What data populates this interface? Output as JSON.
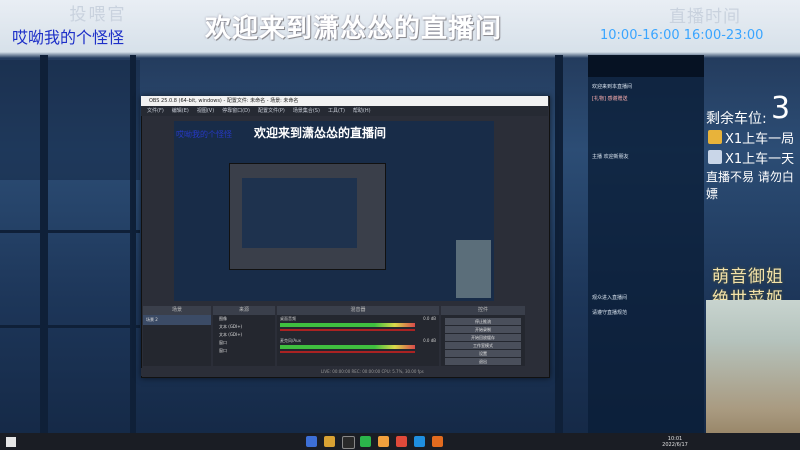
{
  "overlay": {
    "top_left_title": "投喂官",
    "top_left_sub": "哎呦我的个怪怪",
    "main_title": "欢迎来到潇怂怂的直播间",
    "top_right_title": "直播时间",
    "top_right_hours": "10:00-16:00  16:00-23:00"
  },
  "right_panel": {
    "seats_label": "剩余车位:",
    "seats_count": "3",
    "items": [
      {
        "icon": "ticket-icon",
        "label": "X1上车一局"
      },
      {
        "icon": "card-icon",
        "label": "X1上车一天"
      }
    ],
    "notice": "直播不易 请勿白嫖",
    "sign_line_1": "萌音御姐",
    "sign_line_2": "绝世菜姬"
  },
  "obs": {
    "title": "OBS 25.0.8 (64-bit, windows) - 配置文件: 未命名 - 场景: 未命名",
    "menu": [
      "文件(F)",
      "编辑(E)",
      "视图(V)",
      "停靠窗口(D)",
      "配置文件(P)",
      "场景集合(S)",
      "工具(T)",
      "帮助(H)"
    ],
    "scenes_header": "场景",
    "scene_item": "场景 2",
    "sources_header": "来源",
    "sources": [
      "图像",
      "文本 (GDI+)",
      "文本 (GDI+)",
      "窗口",
      "窗口"
    ],
    "mixer_header": "混音器",
    "mixer_tracks": [
      {
        "name": "桌面音频",
        "db": "0.0 dB"
      },
      {
        "name": "麦克风/Aux",
        "db": "0.0 dB"
      }
    ],
    "transition_header": "转场特效",
    "controls_header": "控件",
    "controls": [
      "停止推流",
      "开始录制",
      "开始回放缓存",
      "工作室模式",
      "设置",
      "退出"
    ],
    "status": "LIVE: 00:00:00   REC: 00:00:00   CPU: 5.7%, 30.00 fps"
  },
  "taskbar": {
    "time": "10:01",
    "date": "2022/6/17"
  },
  "chat": {
    "lines": [
      "欢迎来到本直播间",
      "[礼物] 感谢赠送",
      "主播  欢迎新朋友",
      "观众进入直播间",
      "请遵守直播规范"
    ]
  }
}
